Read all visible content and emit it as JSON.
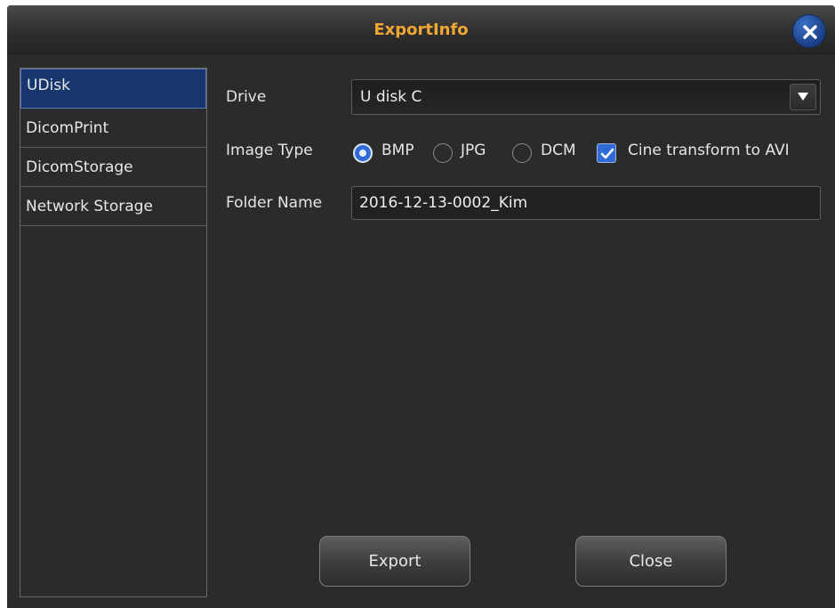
{
  "window": {
    "title": "ExportInfo",
    "close_icon": "close-icon"
  },
  "sidebar": {
    "items": [
      {
        "label": "UDisk",
        "active": true
      },
      {
        "label": "DicomPrint",
        "active": false
      },
      {
        "label": "DicomStorage",
        "active": false
      },
      {
        "label": "Network Storage",
        "active": false
      }
    ]
  },
  "form": {
    "drive": {
      "label": "Drive",
      "value": "U disk C"
    },
    "image_type": {
      "label": "Image Type",
      "options": [
        {
          "label": "BMP",
          "checked": true
        },
        {
          "label": "JPG",
          "checked": false
        },
        {
          "label": "DCM",
          "checked": false
        }
      ],
      "cine_checkbox": {
        "label": "Cine transform to AVI",
        "checked": true
      }
    },
    "folder": {
      "label": "Folder Name",
      "value": "2016-12-13-0002_Kim"
    }
  },
  "buttons": {
    "export": "Export",
    "close": "Close"
  },
  "colors": {
    "title": "#f2a733",
    "accent": "#2f6ad6",
    "selected_bg": "#17366e",
    "panel_bg": "#2b2b2b"
  }
}
